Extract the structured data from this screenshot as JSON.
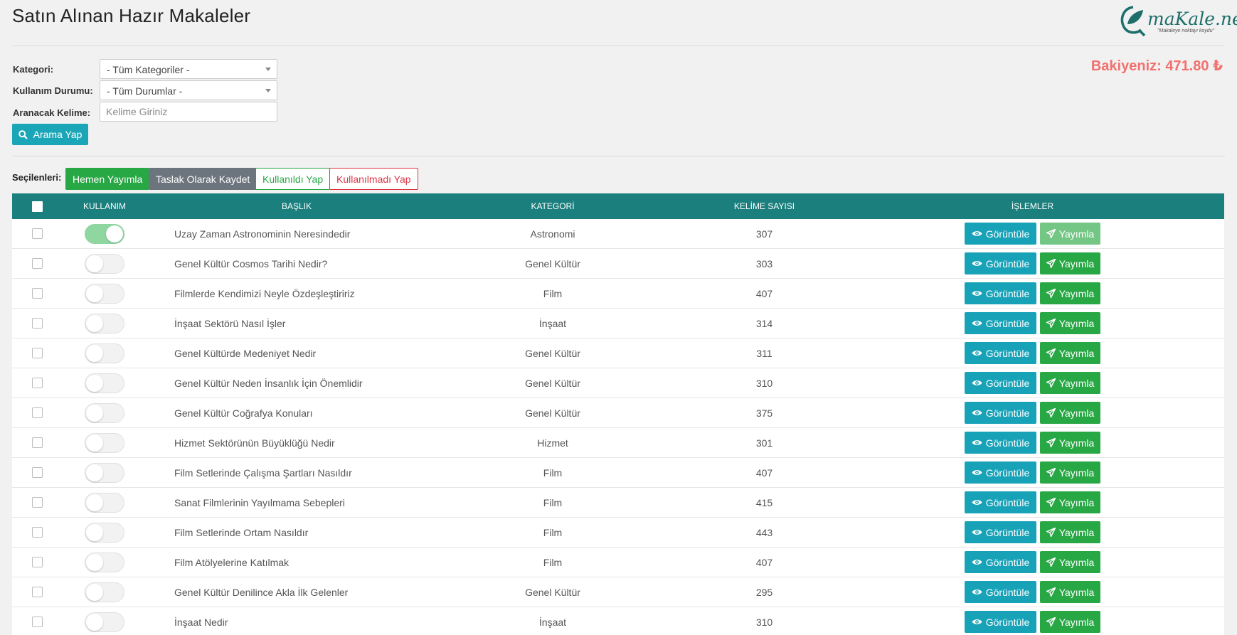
{
  "page": {
    "title": "Satın Alınan Hazır Makaleler"
  },
  "logo": {
    "text": "maKale.net",
    "tagline": "\"Makaleye noktayı koydu\""
  },
  "balance": {
    "label": "Bakiyeniz: 471.80 ₺"
  },
  "filters": {
    "category_label": "Kategori:",
    "category_value": "- Tüm Kategoriler -",
    "usage_label": "Kullanım Durumu:",
    "usage_value": "- Tüm Durumlar -",
    "keyword_label": "Aranacak Kelime:",
    "keyword_placeholder": "Kelime Giriniz",
    "search_button": "Arama Yap"
  },
  "bulk": {
    "label": "Seçilenleri:",
    "publish_now": "Hemen Yayımla",
    "save_draft": "Taslak Olarak Kaydet",
    "mark_used": "Kullanıldı Yap",
    "mark_unused": "Kullanılmadı Yap"
  },
  "table": {
    "headers": {
      "usage": "KULLANIM",
      "title": "BAŞLIK",
      "category": "KATEGORİ",
      "words": "KELİME SAYISI",
      "actions": "İŞLEMLER"
    },
    "view_label": "Görüntüle",
    "publish_label": "Yayımla",
    "rows": [
      {
        "used": true,
        "title": "Uzay Zaman Astronominin Neresindedir",
        "category": "Astronomi",
        "words": "307"
      },
      {
        "used": false,
        "title": "Genel Kültür Cosmos Tarihi Nedir?",
        "category": "Genel Kültür",
        "words": "303"
      },
      {
        "used": false,
        "title": "Filmlerde Kendimizi Neyle Özdeşleştiririz",
        "category": "Film",
        "words": "407"
      },
      {
        "used": false,
        "title": "İnşaat Sektörü Nasıl İşler",
        "category": "İnşaat",
        "words": "314"
      },
      {
        "used": false,
        "title": "Genel Kültürde Medeniyet Nedir",
        "category": "Genel Kültür",
        "words": "311"
      },
      {
        "used": false,
        "title": "Genel Kültür Neden İnsanlık İçin Önemlidir",
        "category": "Genel Kültür",
        "words": "310"
      },
      {
        "used": false,
        "title": "Genel Kültür Coğrafya Konuları",
        "category": "Genel Kültür",
        "words": "375"
      },
      {
        "used": false,
        "title": "Hizmet Sektörünün Büyüklüğü Nedir",
        "category": "Hizmet",
        "words": "301"
      },
      {
        "used": false,
        "title": "Film Setlerinde Çalışma Şartları Nasıldır",
        "category": "Film",
        "words": "407"
      },
      {
        "used": false,
        "title": "Sanat Filmlerinin Yayılmama Sebepleri",
        "category": "Film",
        "words": "415"
      },
      {
        "used": false,
        "title": "Film Setlerinde Ortam Nasıldır",
        "category": "Film",
        "words": "443"
      },
      {
        "used": false,
        "title": "Film Atölyelerine Katılmak",
        "category": "Film",
        "words": "407"
      },
      {
        "used": false,
        "title": "Genel Kültür Denilince Akla İlk Gelenler",
        "category": "Genel Kültür",
        "words": "295"
      },
      {
        "used": false,
        "title": "İnşaat Nedir",
        "category": "İnşaat",
        "words": "310"
      }
    ]
  },
  "colors": {
    "header_bg": "#1a7f7d",
    "balance": "#f1716f",
    "view_btn": "#17a2b8",
    "publish_btn": "#28a745"
  }
}
